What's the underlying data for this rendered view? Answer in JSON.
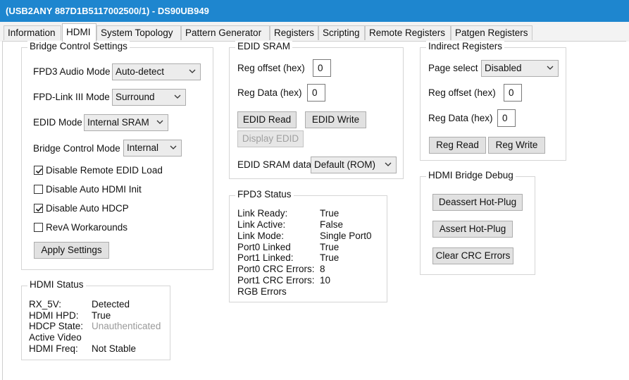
{
  "window": {
    "title": "(USB2ANY 887D1B5117002500/1) - DS90UB949"
  },
  "tabs": [
    "Information",
    "HDMI",
    "System Topology",
    "Pattern Generator",
    "Registers",
    "Scripting",
    "Remote Registers",
    "Patgen Registers"
  ],
  "bridge": {
    "legend": "Bridge Control Settings",
    "fpd3_audio_label": "FPD3 Audio Mode",
    "fpd3_audio_value": "Auto-detect",
    "fpdlink_label": "FPD-Link III Mode",
    "fpdlink_value": "Surround",
    "edid_mode_label": "EDID Mode",
    "edid_mode_value": "Internal SRAM",
    "bridge_mode_label": "Bridge Control Mode",
    "bridge_mode_value": "Internal",
    "checkboxes": [
      {
        "label": "Disable Remote EDID Load",
        "checked": true
      },
      {
        "label": "Disable Auto HDMI Init",
        "checked": false
      },
      {
        "label": "Disable Auto HDCP",
        "checked": true
      },
      {
        "label": "RevA Workarounds",
        "checked": false
      }
    ],
    "apply_label": "Apply Settings"
  },
  "hdmi_status": {
    "legend": "HDMI Status",
    "rows": [
      {
        "label": "RX_5V:",
        "value": "Detected"
      },
      {
        "label": "HDMI HPD:",
        "value": "True"
      },
      {
        "label": "HDCP State:",
        "value": "Unauthenticated"
      },
      {
        "label": "Active Video",
        "value": ""
      },
      {
        "label": "HDMI Freq:",
        "value": "Not Stable"
      }
    ]
  },
  "edid_sram": {
    "legend": "EDID SRAM",
    "reg_offset_label": "Reg offset (hex)",
    "reg_offset_value": "0",
    "reg_data_label": "Reg Data (hex)",
    "reg_data_value": "0",
    "read_label": "EDID Read",
    "write_label": "EDID Write",
    "display_label": "Display EDID",
    "sram_data_label": "EDID SRAM data",
    "sram_data_value": "Default (ROM)"
  },
  "fpd3_status": {
    "legend": "FPD3 Status",
    "rows": [
      {
        "label": "Link Ready:",
        "value": "True"
      },
      {
        "label": "Link Active:",
        "value": "False"
      },
      {
        "label": "Link Mode:",
        "value": "Single Port0"
      },
      {
        "label": "Port0 Linked",
        "value": "True"
      },
      {
        "label": "Port1 Linked:",
        "value": "True"
      },
      {
        "label": "Port0 CRC Errors:",
        "value": "8"
      },
      {
        "label": "Port1 CRC Errors:",
        "value": "10"
      },
      {
        "label": "RGB Errors",
        "value": ""
      }
    ]
  },
  "indirect": {
    "legend": "Indirect Registers",
    "page_label": "Page select",
    "page_value": "Disabled",
    "reg_offset_label": "Reg offset (hex)",
    "reg_offset_value": "0",
    "reg_data_label": "Reg Data (hex)",
    "reg_data_value": "0",
    "read_label": "Reg Read",
    "write_label": "Reg Write"
  },
  "debug": {
    "legend": "HDMI Bridge Debug",
    "deassert_label": "Deassert Hot-Plug",
    "assert_label": "Assert Hot-Plug",
    "clear_label": "Clear CRC Errors"
  },
  "colors": {
    "titlebar": "#1e86cf",
    "muted_text": "#9a9a9a"
  }
}
